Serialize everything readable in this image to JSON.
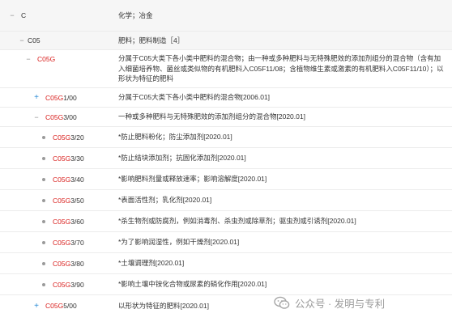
{
  "rows": [
    {
      "toggle": "−",
      "code_red": "",
      "code_black": "C",
      "desc": "化学；冶金"
    },
    {
      "toggle": "−",
      "code_red": "",
      "code_black": "C05",
      "desc": "肥料；肥料制造［4］"
    },
    {
      "toggle": "−",
      "code_red": "C05G",
      "code_black": "",
      "desc": "分属于C05大类下各小类中肥料的混合物；由一种或多种肥料与无特殊肥效的添加剂组分的混合物（含有加入细菌培养物、菌丝或类似物的有机肥料入C05F11/08；含植物维生素或激素的有机肥料入C05F11/10）；以形状为特征的肥料"
    },
    {
      "toggle": "+",
      "code_red": "C05G",
      "code_black": "1/00",
      "desc": "分属于C05大类下各小类中肥料的混合物[2006.01]"
    },
    {
      "toggle": "−",
      "code_red": "C05G",
      "code_black": "3/00",
      "desc": "一种或多种肥料与无特殊肥效的添加剂组分的混合物[2020.01]"
    },
    {
      "toggle": "•",
      "code_red": "C05G",
      "code_black": "3/20",
      "desc": "*防止肥料粉化；防尘添加剂[2020.01]"
    },
    {
      "toggle": "•",
      "code_red": "C05G",
      "code_black": "3/30",
      "desc": "*防止结块添加剂；抗固化添加剂[2020.01]"
    },
    {
      "toggle": "•",
      "code_red": "C05G",
      "code_black": "3/40",
      "desc": "*影响肥料剂量或释放速率；影响溶解度[2020.01]"
    },
    {
      "toggle": "•",
      "code_red": "C05G",
      "code_black": "3/50",
      "desc": "*表面活性剂；乳化剂[2020.01]"
    },
    {
      "toggle": "•",
      "code_red": "C05G",
      "code_black": "3/60",
      "desc": "*杀生物剂或防腐剂，例如消毒剂、杀虫剂或除草剂；驱虫剂或引诱剂[2020.01]"
    },
    {
      "toggle": "•",
      "code_red": "C05G",
      "code_black": "3/70",
      "desc": "*为了影响润湿性，例如干燥剂[2020.01]"
    },
    {
      "toggle": "•",
      "code_red": "C05G",
      "code_black": "3/80",
      "desc": "*土壤调理剂[2020.01]"
    },
    {
      "toggle": "•",
      "code_red": "C05G",
      "code_black": "3/90",
      "desc": "*影响土壤中铵化合物或尿素的硝化作用[2020.01]"
    },
    {
      "toggle": "+",
      "code_red": "C05G",
      "code_black": "5/00",
      "desc": "以形状为特征的肥料[2020.01]"
    }
  ],
  "watermark": {
    "text": "公众号 · 发明与专利",
    "icon": "wechat-icon"
  },
  "colors": {
    "code_red": "#d9201e",
    "expand_blue": "#2a8bd6",
    "shaded_row": "#f6f6f6"
  }
}
